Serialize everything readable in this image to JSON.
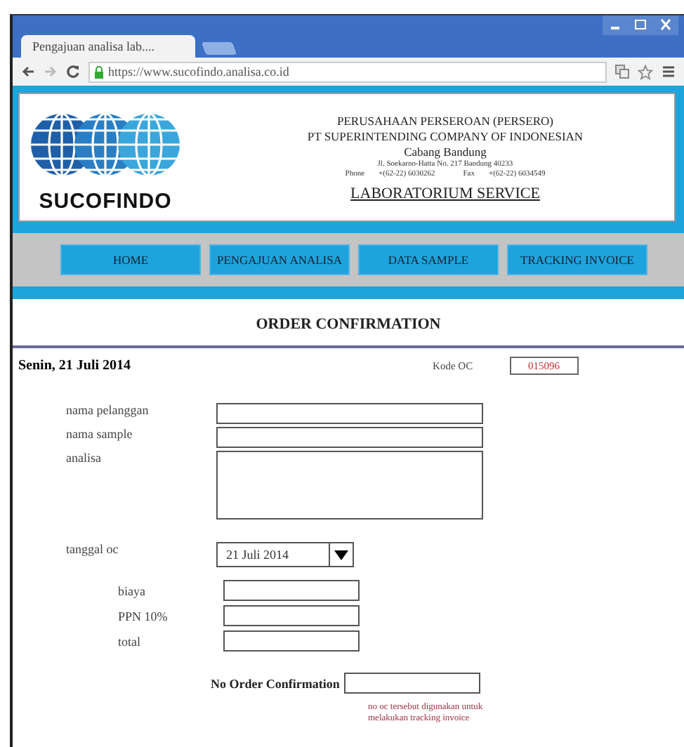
{
  "browser": {
    "tab_title": "Pengajuan analisa lab....",
    "url": "https://www.sucofindo.analisa.co.id"
  },
  "header": {
    "logo_text": "SUCOFINDO",
    "lines": [
      "PERUSAHAAN PERSEROAN (PERSERO)",
      "PT SUPERINTENDING COMPANY OF INDONESIAN",
      "Cabang Bandung"
    ],
    "address": "Jl. Soekarno-Hatta No. 217 Bandung 40233",
    "phone_label": "Phone",
    "phone": "+(62-22) 6030262",
    "fax_label": "Fax",
    "fax": "+(62-22) 6034549",
    "service": "LABORATORIUM SERVICE"
  },
  "nav": [
    "HOME",
    "PENGAJUAN ANALISA",
    "DATA SAMPLE",
    "TRACKING INVOICE"
  ],
  "page_title": "ORDER CONFIRMATION",
  "date": "Senin, 21 Juli 2014",
  "kode_oc": {
    "label": "Kode OC",
    "value": "015096"
  },
  "fields": [
    {
      "label": "nama pelanggan",
      "kind": "text"
    },
    {
      "label": "nama sample",
      "kind": "text"
    },
    {
      "label": "analisa",
      "kind": "textarea"
    },
    {
      "label": "tanggal oc",
      "kind": "select",
      "value": "21 Juli 2014"
    }
  ],
  "costs": [
    {
      "label": "biaya"
    },
    {
      "label": "PPN 10%"
    },
    {
      "label": "total"
    }
  ],
  "order_confirmation": {
    "label": "No Order Confirmation",
    "note": "no oc tersebut digunakan untuk melakukan tracking invoice"
  }
}
